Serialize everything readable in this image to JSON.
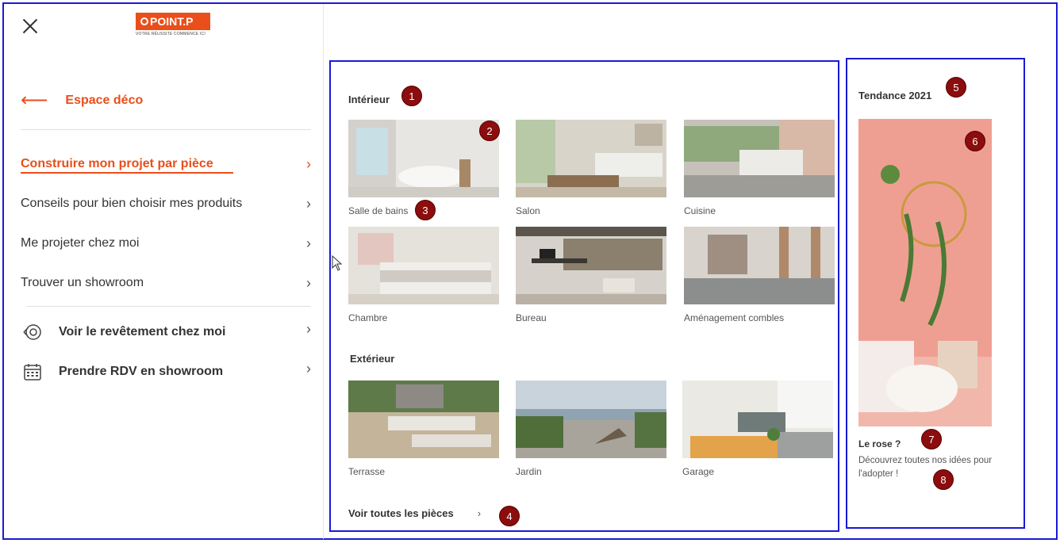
{
  "logo": {
    "brand": "POINT.P",
    "tagline": "VOTRE RÉUSSITE COMMENCE ICI"
  },
  "sidebar": {
    "back_label": "Espace déco",
    "items": [
      {
        "label": "Construire mon projet par pièce",
        "active": true
      },
      {
        "label": "Conseils pour bien choisir mes produits",
        "active": false
      },
      {
        "label": "Me projeter chez moi",
        "active": false
      },
      {
        "label": "Trouver un showroom",
        "active": false
      }
    ],
    "tools": [
      {
        "label": "Voir le revêtement chez moi",
        "icon": "camera-scan-icon"
      },
      {
        "label": "Prendre RDV en showroom",
        "icon": "calendar-icon"
      }
    ]
  },
  "interior": {
    "title": "Intérieur",
    "rooms": [
      "Salle de bains",
      "Salon",
      "Cuisine",
      "Chambre",
      "Bureau",
      "Aménagement combles"
    ]
  },
  "exterior": {
    "title": "Extérieur",
    "rooms": [
      "Terrasse",
      "Jardin",
      "Garage"
    ]
  },
  "see_all": "Voir toutes les pièces",
  "trend": {
    "title": "Tendance 2021",
    "card_title": "Le rose ?",
    "card_desc": "Découvrez toutes nos idées pour l'adopter !"
  },
  "badges": [
    "1",
    "2",
    "3",
    "4",
    "5",
    "6",
    "7",
    "8"
  ],
  "colors": {
    "accent": "#e94e1b",
    "annotation_border": "#1a1ad6",
    "badge": "#8b0d0d"
  }
}
